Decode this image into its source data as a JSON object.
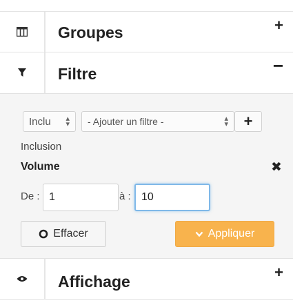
{
  "groupes": {
    "title": "Groupes",
    "toggle": "+",
    "icon": "table-columns-icon"
  },
  "filtre": {
    "title": "Filtre",
    "toggle": "−",
    "icon": "funnel-icon"
  },
  "filter_form": {
    "mode_select": "Inclu",
    "add_filter_select": "- Ajouter un filtre -",
    "add_button": "+",
    "inclusion_label": "Inclusion",
    "field_label": "Volume",
    "remove": "✖",
    "from_label": "De :",
    "from_value": "1",
    "to_label": "à :",
    "to_value": "10",
    "clear_button": "Effacer",
    "apply_button": "Appliquer",
    "apply_color": "#f8b34d"
  },
  "affichage": {
    "title": "Affichage",
    "toggle": "+",
    "icon": "eye-icon"
  }
}
